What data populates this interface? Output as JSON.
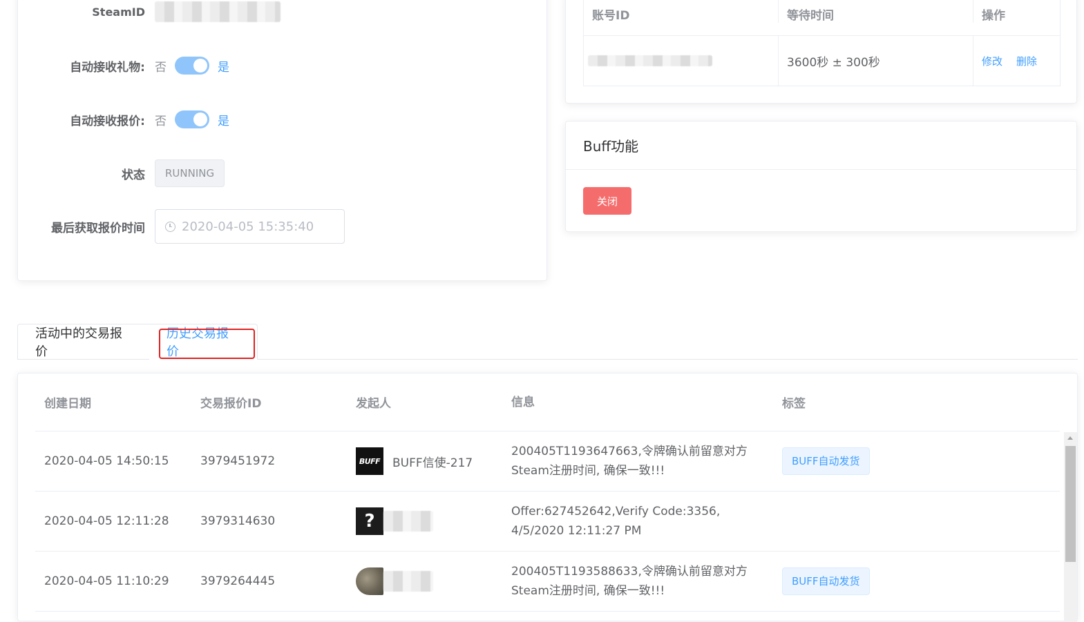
{
  "settings": {
    "steamid_label": "SteamID",
    "auto_gift_label": "自动接收礼物:",
    "auto_offer_label": "自动接收报价:",
    "switch_off": "否",
    "switch_on": "是",
    "status_label": "状态",
    "status_value": "RUNNING",
    "last_fetch_label": "最后获取报价时间",
    "last_fetch_value": "2020-04-05 15:35:40"
  },
  "account_table": {
    "headers": [
      "账号ID",
      "等待时间",
      "操作"
    ],
    "rows": [
      {
        "wait_time": "3600秒 ± 300秒",
        "edit": "修改",
        "delete": "删除"
      }
    ]
  },
  "buff": {
    "title": "Buff功能",
    "close_button": "关闭",
    "button_color": "#f56c6c"
  },
  "tabs": [
    {
      "label": "活动中的交易报价",
      "active": false
    },
    {
      "label": "历史交易报价",
      "active": true
    }
  ],
  "offers": {
    "headers": [
      "创建日期",
      "交易报价ID",
      "发起人",
      "信息",
      "标签"
    ],
    "rows": [
      {
        "date": "2020-04-05 14:50:15",
        "offer_id": "3979451972",
        "avatar": "buff-logo-avatar",
        "avatar_text": "BUFF",
        "sender": "BUFF信使-217",
        "info": "200405T1193647663,令牌确认前留意对方Steam注册时间, 确保一致!!!",
        "tag": "BUFF自动发货"
      },
      {
        "date": "2020-04-05 12:11:28",
        "offer_id": "3979314630",
        "avatar": "unknown-avatar",
        "avatar_text": "?",
        "sender": "",
        "info": "Offer:627452642,Verify Code:3356, 4/5/2020 12:11:27 PM",
        "tag": ""
      },
      {
        "date": "2020-04-05 11:10:29",
        "offer_id": "3979264445",
        "avatar": "photo-avatar",
        "avatar_text": "",
        "sender": "",
        "info": "200405T1193588633,令牌确认前留意对方Steam注册时间, 确保一致!!!",
        "tag": "BUFF自动发货"
      }
    ]
  },
  "colors": {
    "primary": "#409eff",
    "danger": "#f56c6c",
    "highlight": "#e02020"
  }
}
